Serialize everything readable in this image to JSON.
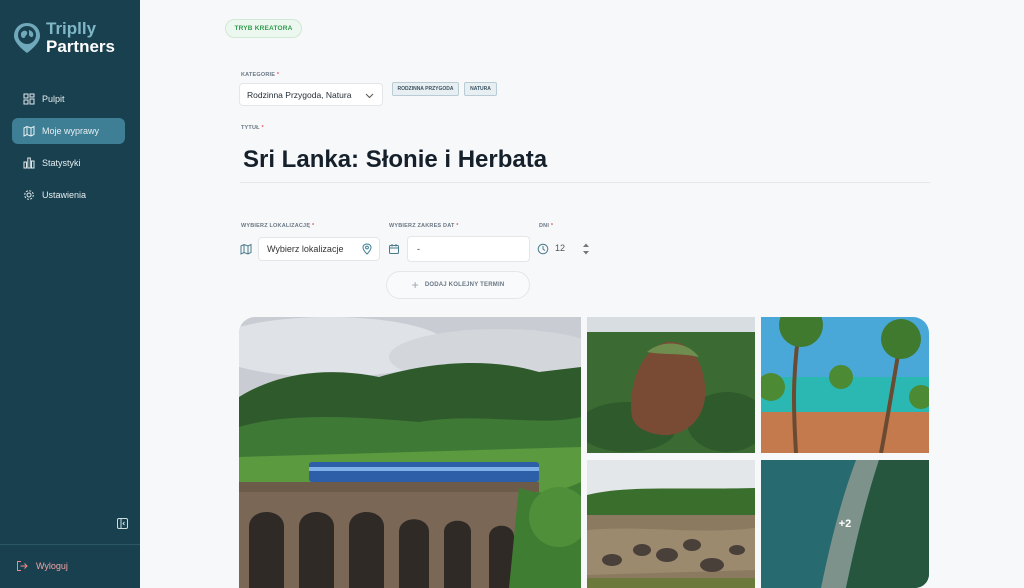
{
  "brand": {
    "line1": "Triplly",
    "line2": "Partners"
  },
  "sidebar": {
    "items": [
      {
        "label": "Pulpit",
        "icon": "dashboard-icon",
        "active": false
      },
      {
        "label": "Moje wyprawy",
        "icon": "map-icon",
        "active": true
      },
      {
        "label": "Statystyki",
        "icon": "chart-icon",
        "active": false
      },
      {
        "label": "Ustawienia",
        "icon": "gear-icon",
        "active": false
      }
    ],
    "logout": "Wyloguj"
  },
  "mode": "TRYB KREATORA",
  "category": {
    "label": "KATEGORIE",
    "required": "*",
    "value": "Rodzinna Przygoda, Natura",
    "tags": [
      "RODZINNA PRZYGODA",
      "NATURA"
    ]
  },
  "title": {
    "label": "TYTUŁ",
    "required": "*",
    "value": "Sri Lanka: Słonie i Herbata"
  },
  "location": {
    "label": "WYBIERZ LOKALIZACJĘ",
    "required": "*",
    "placeholder": "Wybierz lokalizacje"
  },
  "dates": {
    "label": "WYBIERZ ZAKRES DAT",
    "required": "*",
    "value": "-"
  },
  "days": {
    "label": "DNI",
    "required": "*",
    "value": "12"
  },
  "add_term": "DODAJ KOLEJNY TERMIN",
  "gallery": {
    "more_count": "+2"
  },
  "colors": {
    "sidebar": "#19404f",
    "active": "#3e7f95",
    "accent_green": "#2f9a4c"
  }
}
